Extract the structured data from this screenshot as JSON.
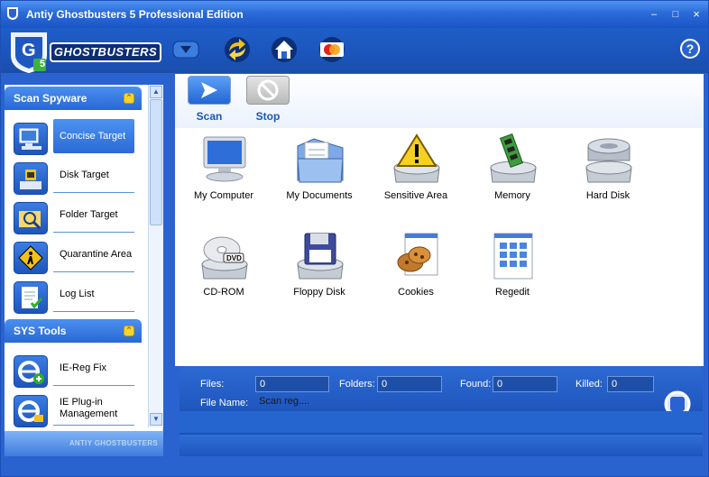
{
  "window": {
    "title": "Antiy Ghostbusters 5 Professional Edition"
  },
  "toolbar": {
    "logo_text": "GHOSTBUSTERS",
    "logo_badge": "5",
    "help_label": "?",
    "buttons": [
      "dropdown-icon",
      "update-icon",
      "home-icon",
      "mastercard-icon"
    ]
  },
  "sidebar": {
    "sections": [
      {
        "title": "Scan Spyware",
        "items": [
          {
            "label": "Concise Target",
            "icon": "computer-icon",
            "active": true
          },
          {
            "label": "Disk Target",
            "icon": "disk-target-icon"
          },
          {
            "label": "Folder Target",
            "icon": "folder-search-icon"
          },
          {
            "label": "Quarantine Area",
            "icon": "caution-sign-icon"
          },
          {
            "label": "Log List",
            "icon": "log-checklist-icon"
          }
        ]
      },
      {
        "title": "SYS Tools",
        "items": [
          {
            "label": "IE-Reg Fix",
            "icon": "ie-add-icon"
          },
          {
            "label": "IE Plug-in Management",
            "icon": "ie-plugin-icon"
          }
        ]
      }
    ],
    "footer_brand": "ANTIY GHOSTBUSTERS"
  },
  "actions": {
    "scan": "Scan",
    "stop": "Stop"
  },
  "targets": [
    {
      "label": "My Computer",
      "icon": "my-computer-icon"
    },
    {
      "label": "My Documents",
      "icon": "my-documents-icon"
    },
    {
      "label": "Sensitive Area",
      "icon": "sensitive-area-icon"
    },
    {
      "label": "Memory",
      "icon": "memory-icon"
    },
    {
      "label": "Hard Disk",
      "icon": "hard-disk-icon"
    },
    {
      "label": "CD-ROM",
      "icon": "cd-rom-icon"
    },
    {
      "label": "Floppy Disk",
      "icon": "floppy-disk-icon"
    },
    {
      "label": "Cookies",
      "icon": "cookies-icon"
    },
    {
      "label": "Regedit",
      "icon": "regedit-icon"
    }
  ],
  "status": {
    "files_label": "Files:",
    "files_value": "0",
    "folders_label": "Folders:",
    "folders_value": "0",
    "found_label": "Found:",
    "found_value": "0",
    "killed_label": "Killed:",
    "killed_value": "0",
    "filename_label": "File Name:",
    "filename_value": "Scan reg....",
    "dvd_text": "DVD"
  },
  "colors": {
    "accent": "#2a62d0",
    "title_bar": "#2a6ad9",
    "highlight": "#4c92f0"
  }
}
